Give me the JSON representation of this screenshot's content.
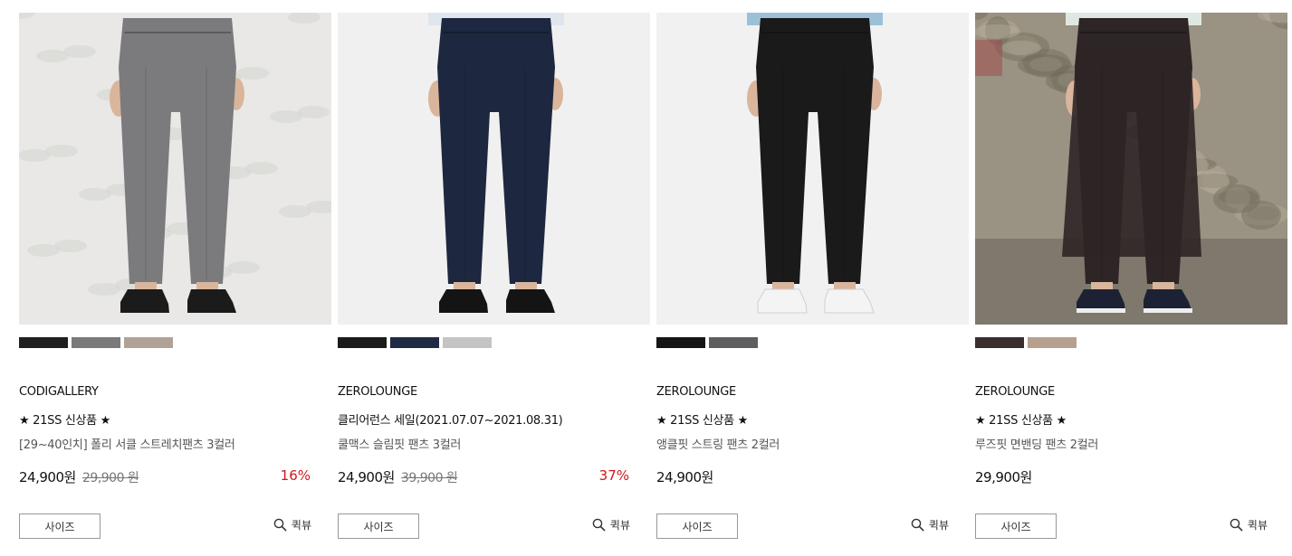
{
  "products": [
    {
      "brand": "CODIGALLERY",
      "promo": "★ 21SS 신상품 ★",
      "name": "[29~40인치] 폴리 서클 스트레치팬츠 3컬러",
      "price": "24,900원",
      "original_price": "29,900 원",
      "discount": "16%",
      "swatches": [
        "#1f1f1f",
        "#7a7a7a",
        "#b0a294"
      ],
      "photo": {
        "bg": "#e9e8e6",
        "pants": "#7b7b7d",
        "shoes": "#1b1b1b",
        "shirt": "#e9e8e6"
      },
      "size_label": "사이즈",
      "quickview_label": "퀵뷰"
    },
    {
      "brand": "ZEROLOUNGE",
      "promo": "클리어런스 세일(2021.07.07~2021.08.31)",
      "name": "쿨맥스 슬림핏 팬츠 3컬러",
      "price": "24,900원",
      "original_price": "39,900 원",
      "discount": "37%",
      "swatches": [
        "#1b1b1b",
        "#1f2a44",
        "#c4c4c4"
      ],
      "photo": {
        "bg": "#f0f0f0",
        "pants": "#1e2740",
        "shoes": "#141414",
        "shirt": "#dfe6ee"
      },
      "size_label": "사이즈",
      "quickview_label": "퀵뷰"
    },
    {
      "brand": "ZEROLOUNGE",
      "promo": "★ 21SS 신상품 ★",
      "name": "앵클핏 스트링 팬츠 2컬러",
      "price": "24,900원",
      "original_price": "",
      "discount": "",
      "swatches": [
        "#151515",
        "#5e5e60"
      ],
      "photo": {
        "bg": "#f1f1f1",
        "pants": "#1a1a1a",
        "shoes": "#f4f4f4",
        "shirt": "#9cc0d8"
      },
      "size_label": "사이즈",
      "quickview_label": "퀵뷰"
    },
    {
      "brand": "ZEROLOUNGE",
      "promo": "★ 21SS 신상품 ★",
      "name": "루즈핏 면밴딩 팬츠 2컬러",
      "price": "29,900원",
      "original_price": "",
      "discount": "",
      "swatches": [
        "#3a2d2e",
        "#b8a08e"
      ],
      "photo": {
        "bg": "#9a9282",
        "pants": "#2d2526",
        "shoes": "#1c2233",
        "shirt": "#dfe8e0"
      },
      "size_label": "사이즈",
      "quickview_label": "퀵뷰"
    }
  ]
}
